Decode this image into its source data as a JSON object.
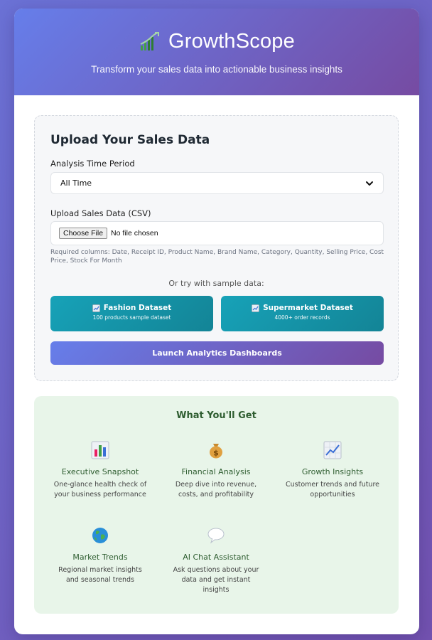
{
  "header": {
    "app_name": "GrowthScope",
    "tagline": "Transform your sales data into actionable business insights",
    "logo_icon": "growth-chart-icon"
  },
  "upload": {
    "title": "Upload Your Sales Data",
    "period_label": "Analysis Time Period",
    "period_selected": "All Time",
    "file_label": "Upload Sales Data (CSV)",
    "choose_file": "Choose File",
    "no_file": "No file chosen",
    "required_columns": "Required columns: Date, Receipt ID, Product Name, Brand Name, Category, Quantity, Selling Price, Cost Price, Stock For Month",
    "sample_prompt": "Or try with sample data:",
    "datasets": [
      {
        "title": "Fashion Dataset",
        "subtitle": "100 products sample dataset",
        "icon": "chart-icon"
      },
      {
        "title": "Supermarket Dataset",
        "subtitle": "4000+ order records",
        "icon": "chart-icon"
      }
    ],
    "launch_label": "Launch Analytics Dashboards"
  },
  "features": {
    "title": "What You'll Get",
    "items": [
      {
        "name": "Executive Snapshot",
        "desc_1": "One-glance health check of",
        "desc_2": "your business performance",
        "desc_3": "",
        "icon": "bar-chart-icon"
      },
      {
        "name": "Financial Analysis",
        "desc_1": "Deep dive into revenue,",
        "desc_2": "costs, and profitability",
        "desc_3": "",
        "icon": "money-bag-icon"
      },
      {
        "name": "Growth Insights",
        "desc_1": "Customer trends and future",
        "desc_2": "opportunities",
        "desc_3": "",
        "icon": "trending-up-icon"
      },
      {
        "name": "Market Trends",
        "desc_1": "Regional market insights",
        "desc_2": "and seasonal trends",
        "desc_3": "",
        "icon": "globe-icon"
      },
      {
        "name": "AI Chat Assistant",
        "desc_1": "Ask questions about your",
        "desc_2": "data and get instant",
        "desc_3": "insights",
        "icon": "speech-bubble-icon"
      }
    ]
  },
  "colors": {
    "primary_gradient_start": "#667eea",
    "primary_gradient_end": "#764ba2",
    "teal": "#17a2b8",
    "features_bg": "#e8f5e9",
    "features_text": "#2e5d30"
  }
}
